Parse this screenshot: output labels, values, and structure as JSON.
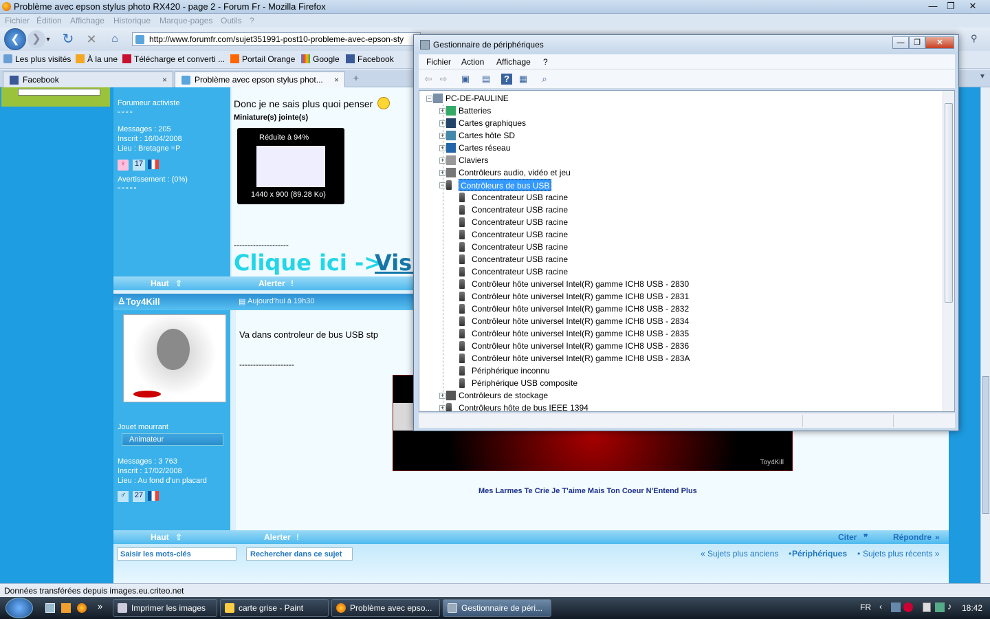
{
  "firefox": {
    "title": "Problème avec epson stylus photo RX420 - page 2 - Forum Fr - Mozilla Firefox",
    "window_controls": [
      "—",
      "❐",
      "✕"
    ],
    "menu": [
      "Fichier",
      "Édition",
      "Affichage",
      "Historique",
      "Marque-pages",
      "Outils",
      "?"
    ],
    "url": "http://www.forumfr.com/sujet351991-post10-probleme-avec-epson-sty",
    "bookmarks": [
      "Les plus visités",
      "À la une",
      "Télécharge et converti ...",
      "Portail Orange",
      "Google",
      "Facebook"
    ],
    "tabs": [
      {
        "label": "Facebook",
        "close": "×"
      },
      {
        "label": "Problème avec epson stylus phot...",
        "close": "×"
      }
    ],
    "new_tab": "+",
    "status": "Données transférées depuis images.eu.criteo.net"
  },
  "forum": {
    "post1": {
      "rank": "Forumeur activiste",
      "messages": "Messages : 205",
      "inscrit": "Inscrit : 16/04/2008",
      "lieu": "Lieu : Bretagne =P",
      "age": "17",
      "avertissement": "Avertissement : (0%)",
      "text": "Donc je ne sais plus quoi penser",
      "attach_label": "Miniature(s) jointe(s)",
      "thumb_reduced": "Réduite à 94%",
      "thumb_info": "1440 x 900 (89.28 Ko)",
      "separator": "--------------------",
      "sig_text": "Clique ici ->",
      "sig_link": "Visi",
      "haut": "Haut",
      "alerter": "Alerter"
    },
    "post2": {
      "username": "Toy4Kill",
      "date": "Aujourd'hui à 19h30",
      "rank": "Jouet mourrant",
      "role": "Animateur",
      "messages": "Messages : 3 763",
      "inscrit": "Inscrit : 17/02/2008",
      "lieu": "Lieu : Au fond d'un placard",
      "age": "27",
      "text": "Va dans controleur de bus USB stp",
      "separator": "--------------------",
      "sig_watermark": "Toy4Kill",
      "sig_caption": "Mes Larmes Te Crie Je T'aime Mais Ton Coeur N'Entend Plus",
      "haut": "Haut",
      "alerter": "Alerter",
      "citer": "Citer",
      "repondre": "Répondre"
    },
    "search_placeholder": "Saisir les mots-clés",
    "search_button": "Rechercher dans ce sujet",
    "nav_prev": "« Sujets plus anciens",
    "nav_cat": "Périphériques",
    "nav_next": "Sujets plus récents »"
  },
  "device_manager": {
    "title": "Gestionnaire de périphériques",
    "controls": [
      "—",
      "❐",
      "✕"
    ],
    "menu": [
      "Fichier",
      "Action",
      "Affichage",
      "?"
    ],
    "root": "PC-DE-PAULINE",
    "categories_before": [
      "Batteries",
      "Cartes graphiques",
      "Cartes hôte SD",
      "Cartes réseau",
      "Claviers",
      "Contrôleurs audio, vidéo et jeu"
    ],
    "selected_category": "Contrôleurs de bus USB",
    "usb_devices": [
      "Concentrateur USB racine",
      "Concentrateur USB racine",
      "Concentrateur USB racine",
      "Concentrateur USB racine",
      "Concentrateur USB racine",
      "Concentrateur USB racine",
      "Concentrateur USB racine",
      "Contrôleur hôte universel Intel(R) gamme ICH8 USB - 2830",
      "Contrôleur hôte universel Intel(R) gamme ICH8 USB - 2831",
      "Contrôleur hôte universel Intel(R) gamme ICH8 USB - 2832",
      "Contrôleur hôte universel Intel(R) gamme ICH8 USB - 2834",
      "Contrôleur hôte universel Intel(R) gamme ICH8 USB - 2835",
      "Contrôleur hôte universel Intel(R) gamme ICH8 USB - 2836",
      "Contrôleur hôte universel Intel(R) gamme ICH8 USB - 283A",
      "Périphérique inconnu",
      "Périphérique USB composite"
    ],
    "categories_after": [
      "Contrôleurs de stockage",
      "Contrôleurs hôte de bus IEEE 1394"
    ]
  },
  "taskbar": {
    "items": [
      "Imprimer les images",
      "carte grise - Paint",
      "Problème avec epso...",
      "Gestionnaire de péri..."
    ],
    "lang": "FR",
    "clock": "18:42",
    "more": "»"
  }
}
